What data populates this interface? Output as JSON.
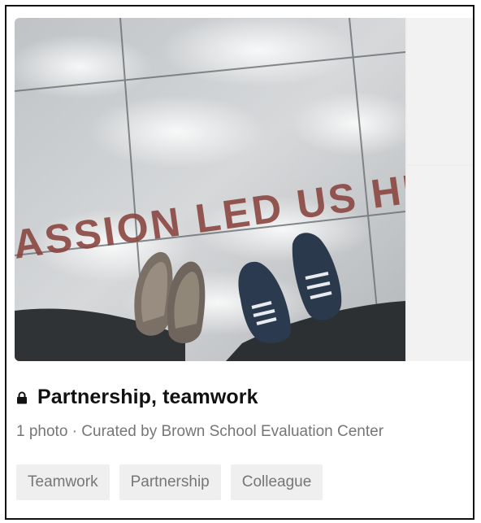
{
  "collection": {
    "title": "Partnership, teamwork",
    "visibility_icon": "lock-icon",
    "meta": "1 photo · Curated by Brown School Evaluation Center",
    "tags": [
      "Teamwork",
      "Partnership",
      "Colleague"
    ]
  },
  "photo": {
    "ground_text": "ASSION LED US HE"
  },
  "colors": {
    "title": "#111111",
    "meta": "#767676",
    "tag_bg": "#efefef",
    "placeholder_bg": "#f2f2f2"
  }
}
